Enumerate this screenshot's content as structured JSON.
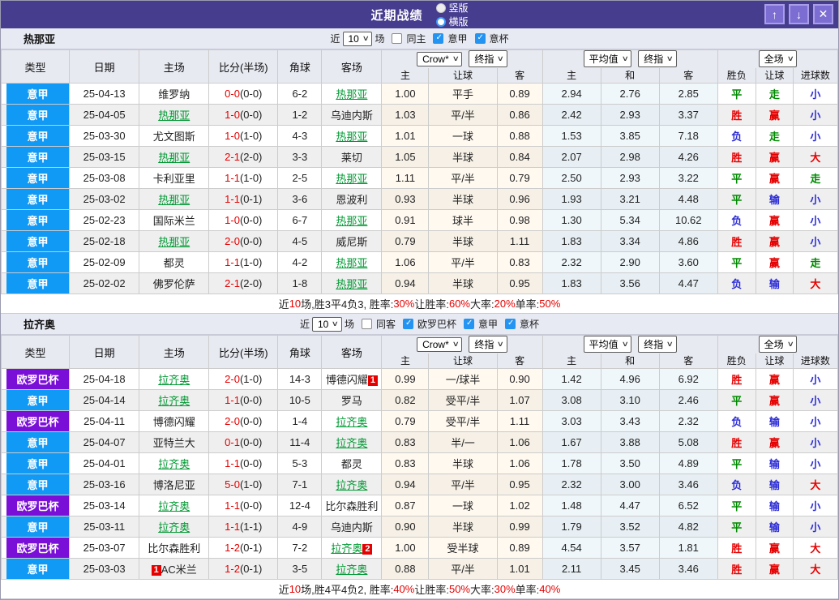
{
  "titlebar": {
    "title": "近期战绩",
    "radios": [
      {
        "label": "竖版",
        "selected": false
      },
      {
        "label": "横版",
        "selected": true
      }
    ],
    "buttons": [
      {
        "name": "scroll-up-button",
        "glyph": "↑"
      },
      {
        "name": "scroll-down-button",
        "glyph": "↓"
      },
      {
        "name": "close-button",
        "glyph": "✕"
      }
    ]
  },
  "columns": {
    "static": [
      "类型",
      "日期",
      "主场",
      "比分(半场)",
      "角球",
      "客场"
    ],
    "group1_selects": [
      "Crow*",
      "终指"
    ],
    "group1_cols": [
      "主",
      "让球",
      "客"
    ],
    "group2_selects": [
      "平均值",
      "终指"
    ],
    "group2_cols": [
      "主",
      "和",
      "客"
    ],
    "group3_selects": [
      "全场"
    ],
    "group3_cols": [
      "胜负",
      "让球",
      "进球数"
    ]
  },
  "colors": {
    "accent_titlebar": "#463D8F",
    "league_blue": "#119AF5",
    "europa_purple": "#7A10D8",
    "focus_team_green": "#009933",
    "score_red": "#E60000",
    "loss_blue": "#2B2BD5"
  },
  "sections": [
    {
      "team": "热那亚",
      "filter": {
        "near_label": "近",
        "count": "10",
        "games_label": "场",
        "checks": [
          {
            "label": "同主",
            "checked": false
          },
          {
            "label": "意甲",
            "checked": true
          },
          {
            "label": "意杯",
            "checked": true
          }
        ]
      },
      "rows": [
        {
          "comp": "意甲",
          "compType": "l",
          "date": "25-04-13",
          "home": "维罗纳",
          "homeFocus": false,
          "homeCard": null,
          "score": "0-0",
          "half": "0-0",
          "corner": "6-2",
          "away": "热那亚",
          "awayFocus": true,
          "awayCard": null,
          "crow": [
            "1.00",
            "平手",
            "0.89"
          ],
          "avg": [
            "2.94",
            "2.76",
            "2.85"
          ],
          "res": [
            [
              "平",
              "g"
            ],
            [
              "走",
              "g"
            ],
            [
              "小",
              "b"
            ]
          ]
        },
        {
          "comp": "意甲",
          "compType": "l",
          "date": "25-04-05",
          "home": "热那亚",
          "homeFocus": true,
          "homeCard": null,
          "score": "1-0",
          "half": "0-0",
          "corner": "1-2",
          "away": "乌迪内斯",
          "awayFocus": false,
          "awayCard": null,
          "crow": [
            "1.03",
            "平/半",
            "0.86"
          ],
          "avg": [
            "2.42",
            "2.93",
            "3.37"
          ],
          "res": [
            [
              "胜",
              "r"
            ],
            [
              "赢",
              "r"
            ],
            [
              "小",
              "b"
            ]
          ]
        },
        {
          "comp": "意甲",
          "compType": "l",
          "date": "25-03-30",
          "home": "尤文图斯",
          "homeFocus": false,
          "homeCard": null,
          "score": "1-0",
          "half": "1-0",
          "corner": "4-3",
          "away": "热那亚",
          "awayFocus": true,
          "awayCard": null,
          "crow": [
            "1.01",
            "一球",
            "0.88"
          ],
          "avg": [
            "1.53",
            "3.85",
            "7.18"
          ],
          "res": [
            [
              "负",
              "b"
            ],
            [
              "走",
              "g"
            ],
            [
              "小",
              "b"
            ]
          ]
        },
        {
          "comp": "意甲",
          "compType": "l",
          "date": "25-03-15",
          "home": "热那亚",
          "homeFocus": true,
          "homeCard": null,
          "score": "2-1",
          "half": "2-0",
          "corner": "3-3",
          "away": "莱切",
          "awayFocus": false,
          "awayCard": null,
          "crow": [
            "1.05",
            "半球",
            "0.84"
          ],
          "avg": [
            "2.07",
            "2.98",
            "4.26"
          ],
          "res": [
            [
              "胜",
              "r"
            ],
            [
              "赢",
              "r"
            ],
            [
              "大",
              "r"
            ]
          ]
        },
        {
          "comp": "意甲",
          "compType": "l",
          "date": "25-03-08",
          "home": "卡利亚里",
          "homeFocus": false,
          "homeCard": null,
          "score": "1-1",
          "half": "1-0",
          "corner": "2-5",
          "away": "热那亚",
          "awayFocus": true,
          "awayCard": null,
          "crow": [
            "1.11",
            "平/半",
            "0.79"
          ],
          "avg": [
            "2.50",
            "2.93",
            "3.22"
          ],
          "res": [
            [
              "平",
              "g"
            ],
            [
              "赢",
              "r"
            ],
            [
              "走",
              "g"
            ]
          ]
        },
        {
          "comp": "意甲",
          "compType": "l",
          "date": "25-03-02",
          "home": "热那亚",
          "homeFocus": true,
          "homeCard": null,
          "score": "1-1",
          "half": "0-1",
          "corner": "3-6",
          "away": "恩波利",
          "awayFocus": false,
          "awayCard": null,
          "crow": [
            "0.93",
            "半球",
            "0.96"
          ],
          "avg": [
            "1.93",
            "3.21",
            "4.48"
          ],
          "res": [
            [
              "平",
              "g"
            ],
            [
              "输",
              "b"
            ],
            [
              "小",
              "b"
            ]
          ]
        },
        {
          "comp": "意甲",
          "compType": "l",
          "date": "25-02-23",
          "home": "国际米兰",
          "homeFocus": false,
          "homeCard": null,
          "score": "1-0",
          "half": "0-0",
          "corner": "6-7",
          "away": "热那亚",
          "awayFocus": true,
          "awayCard": null,
          "crow": [
            "0.91",
            "球半",
            "0.98"
          ],
          "avg": [
            "1.30",
            "5.34",
            "10.62"
          ],
          "res": [
            [
              "负",
              "b"
            ],
            [
              "赢",
              "r"
            ],
            [
              "小",
              "b"
            ]
          ]
        },
        {
          "comp": "意甲",
          "compType": "l",
          "date": "25-02-18",
          "home": "热那亚",
          "homeFocus": true,
          "homeCard": null,
          "score": "2-0",
          "half": "0-0",
          "corner": "4-5",
          "away": "威尼斯",
          "awayFocus": false,
          "awayCard": null,
          "crow": [
            "0.79",
            "半球",
            "1.11"
          ],
          "avg": [
            "1.83",
            "3.34",
            "4.86"
          ],
          "res": [
            [
              "胜",
              "r"
            ],
            [
              "赢",
              "r"
            ],
            [
              "小",
              "b"
            ]
          ]
        },
        {
          "comp": "意甲",
          "compType": "l",
          "date": "25-02-09",
          "home": "都灵",
          "homeFocus": false,
          "homeCard": null,
          "score": "1-1",
          "half": "1-0",
          "corner": "4-2",
          "away": "热那亚",
          "awayFocus": true,
          "awayCard": null,
          "crow": [
            "1.06",
            "平/半",
            "0.83"
          ],
          "avg": [
            "2.32",
            "2.90",
            "3.60"
          ],
          "res": [
            [
              "平",
              "g"
            ],
            [
              "赢",
              "r"
            ],
            [
              "走",
              "g"
            ]
          ]
        },
        {
          "comp": "意甲",
          "compType": "l",
          "date": "25-02-02",
          "home": "佛罗伦萨",
          "homeFocus": false,
          "homeCard": null,
          "score": "2-1",
          "half": "2-0",
          "corner": "1-8",
          "away": "热那亚",
          "awayFocus": true,
          "awayCard": null,
          "crow": [
            "0.94",
            "半球",
            "0.95"
          ],
          "avg": [
            "1.83",
            "3.56",
            "4.47"
          ],
          "res": [
            [
              "负",
              "b"
            ],
            [
              "输",
              "b"
            ],
            [
              "大",
              "r"
            ]
          ]
        }
      ],
      "summary": [
        [
          "近",
          "k"
        ],
        [
          "10",
          "r"
        ],
        [
          "场,胜3平4负3, 胜率:",
          "k"
        ],
        [
          "30%",
          "r"
        ],
        [
          " 让胜率:",
          "k"
        ],
        [
          "60%",
          "r"
        ],
        [
          " 大率:",
          "k"
        ],
        [
          "20%",
          "r"
        ],
        [
          " 单率:",
          "k"
        ],
        [
          "50%",
          "r"
        ]
      ]
    },
    {
      "team": "拉齐奥",
      "filter": {
        "near_label": "近",
        "count": "10",
        "games_label": "场",
        "checks": [
          {
            "label": "同客",
            "checked": false
          },
          {
            "label": "欧罗巴杯",
            "checked": true
          },
          {
            "label": "意甲",
            "checked": true
          },
          {
            "label": "意杯",
            "checked": true
          }
        ]
      },
      "rows": [
        {
          "comp": "欧罗巴杯",
          "compType": "e",
          "date": "25-04-18",
          "home": "拉齐奥",
          "homeFocus": true,
          "homeCard": null,
          "score": "2-0",
          "half": "1-0",
          "corner": "14-3",
          "away": "博德闪耀",
          "awayFocus": false,
          "awayCard": {
            "v": "1",
            "pos": "after"
          },
          "crow": [
            "0.99",
            "一/球半",
            "0.90"
          ],
          "avg": [
            "1.42",
            "4.96",
            "6.92"
          ],
          "res": [
            [
              "胜",
              "r"
            ],
            [
              "赢",
              "r"
            ],
            [
              "小",
              "b"
            ]
          ]
        },
        {
          "comp": "意甲",
          "compType": "l",
          "date": "25-04-14",
          "home": "拉齐奥",
          "homeFocus": true,
          "homeCard": null,
          "score": "1-1",
          "half": "0-0",
          "corner": "10-5",
          "away": "罗马",
          "awayFocus": false,
          "awayCard": null,
          "crow": [
            "0.82",
            "受平/半",
            "1.07"
          ],
          "avg": [
            "3.08",
            "3.10",
            "2.46"
          ],
          "res": [
            [
              "平",
              "g"
            ],
            [
              "赢",
              "r"
            ],
            [
              "小",
              "b"
            ]
          ]
        },
        {
          "comp": "欧罗巴杯",
          "compType": "e",
          "date": "25-04-11",
          "home": "博德闪耀",
          "homeFocus": false,
          "homeCard": null,
          "score": "2-0",
          "half": "0-0",
          "corner": "1-4",
          "away": "拉齐奥",
          "awayFocus": true,
          "awayCard": null,
          "crow": [
            "0.79",
            "受平/半",
            "1.11"
          ],
          "avg": [
            "3.03",
            "3.43",
            "2.32"
          ],
          "res": [
            [
              "负",
              "b"
            ],
            [
              "输",
              "b"
            ],
            [
              "小",
              "b"
            ]
          ]
        },
        {
          "comp": "意甲",
          "compType": "l",
          "date": "25-04-07",
          "home": "亚特兰大",
          "homeFocus": false,
          "homeCard": null,
          "score": "0-1",
          "half": "0-0",
          "corner": "11-4",
          "away": "拉齐奥",
          "awayFocus": true,
          "awayCard": null,
          "crow": [
            "0.83",
            "半/一",
            "1.06"
          ],
          "avg": [
            "1.67",
            "3.88",
            "5.08"
          ],
          "res": [
            [
              "胜",
              "r"
            ],
            [
              "赢",
              "r"
            ],
            [
              "小",
              "b"
            ]
          ]
        },
        {
          "comp": "意甲",
          "compType": "l",
          "date": "25-04-01",
          "home": "拉齐奥",
          "homeFocus": true,
          "homeCard": null,
          "score": "1-1",
          "half": "0-0",
          "corner": "5-3",
          "away": "都灵",
          "awayFocus": false,
          "awayCard": null,
          "crow": [
            "0.83",
            "半球",
            "1.06"
          ],
          "avg": [
            "1.78",
            "3.50",
            "4.89"
          ],
          "res": [
            [
              "平",
              "g"
            ],
            [
              "输",
              "b"
            ],
            [
              "小",
              "b"
            ]
          ]
        },
        {
          "comp": "意甲",
          "compType": "l",
          "date": "25-03-16",
          "home": "博洛尼亚",
          "homeFocus": false,
          "homeCard": null,
          "score": "5-0",
          "half": "1-0",
          "corner": "7-1",
          "away": "拉齐奥",
          "awayFocus": true,
          "awayCard": null,
          "crow": [
            "0.94",
            "平/半",
            "0.95"
          ],
          "avg": [
            "2.32",
            "3.00",
            "3.46"
          ],
          "res": [
            [
              "负",
              "b"
            ],
            [
              "输",
              "b"
            ],
            [
              "大",
              "r"
            ]
          ]
        },
        {
          "comp": "欧罗巴杯",
          "compType": "e",
          "date": "25-03-14",
          "home": "拉齐奥",
          "homeFocus": true,
          "homeCard": null,
          "score": "1-1",
          "half": "0-0",
          "corner": "12-4",
          "away": "比尔森胜利",
          "awayFocus": false,
          "awayCard": null,
          "crow": [
            "0.87",
            "一球",
            "1.02"
          ],
          "avg": [
            "1.48",
            "4.47",
            "6.52"
          ],
          "res": [
            [
              "平",
              "g"
            ],
            [
              "输",
              "b"
            ],
            [
              "小",
              "b"
            ]
          ]
        },
        {
          "comp": "意甲",
          "compType": "l",
          "date": "25-03-11",
          "home": "拉齐奥",
          "homeFocus": true,
          "homeCard": null,
          "score": "1-1",
          "half": "1-1",
          "corner": "4-9",
          "away": "乌迪内斯",
          "awayFocus": false,
          "awayCard": null,
          "crow": [
            "0.90",
            "半球",
            "0.99"
          ],
          "avg": [
            "1.79",
            "3.52",
            "4.82"
          ],
          "res": [
            [
              "平",
              "g"
            ],
            [
              "输",
              "b"
            ],
            [
              "小",
              "b"
            ]
          ]
        },
        {
          "comp": "欧罗巴杯",
          "compType": "e",
          "date": "25-03-07",
          "home": "比尔森胜利",
          "homeFocus": false,
          "homeCard": null,
          "score": "1-2",
          "half": "0-1",
          "corner": "7-2",
          "away": "拉齐奥",
          "awayFocus": true,
          "awayCard": {
            "v": "2",
            "pos": "after"
          },
          "crow": [
            "1.00",
            "受半球",
            "0.89"
          ],
          "avg": [
            "4.54",
            "3.57",
            "1.81"
          ],
          "res": [
            [
              "胜",
              "r"
            ],
            [
              "赢",
              "r"
            ],
            [
              "大",
              "r"
            ]
          ]
        },
        {
          "comp": "意甲",
          "compType": "l",
          "date": "25-03-03",
          "home": "AC米兰",
          "homeFocus": false,
          "homeCard": {
            "v": "1",
            "pos": "before"
          },
          "score": "1-2",
          "half": "0-1",
          "corner": "3-5",
          "away": "拉齐奥",
          "awayFocus": true,
          "awayCard": null,
          "crow": [
            "0.88",
            "平/半",
            "1.01"
          ],
          "avg": [
            "2.11",
            "3.45",
            "3.46"
          ],
          "res": [
            [
              "胜",
              "r"
            ],
            [
              "赢",
              "r"
            ],
            [
              "大",
              "r"
            ]
          ]
        }
      ],
      "summary": [
        [
          "近",
          "k"
        ],
        [
          "10",
          "r"
        ],
        [
          "场,胜4平4负2, 胜率:",
          "k"
        ],
        [
          "40%",
          "r"
        ],
        [
          " 让胜率:",
          "k"
        ],
        [
          "50%",
          "r"
        ],
        [
          " 大率:",
          "k"
        ],
        [
          "30%",
          "r"
        ],
        [
          " 单率:",
          "k"
        ],
        [
          "40%",
          "r"
        ]
      ]
    }
  ]
}
